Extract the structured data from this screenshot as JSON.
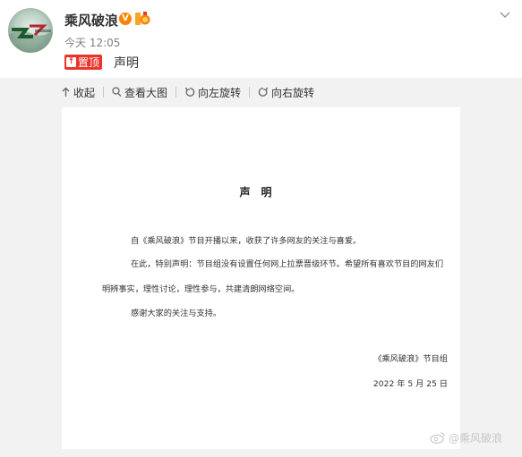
{
  "post": {
    "username": "乘风破浪",
    "verified_badge": "V",
    "timestamp": "今天 12:05",
    "pin_label": "置顶",
    "text": "声明"
  },
  "toolbar": {
    "collapse": "收起",
    "view_large": "查看大图",
    "rotate_left": "向左旋转",
    "rotate_right": "向右旋转"
  },
  "document": {
    "title": "声明",
    "paragraph1": "自《乘风破浪》节目开播以来，收获了许多网友的关注与喜爱。",
    "paragraph2_line1": "在此，特别声明：节目组没有设置任何网上拉票晋级环节。希望所有喜欢节目的网友们",
    "paragraph2_line2": "明辨事实，理性讨论，理性参与，共建清朗网络空间。",
    "paragraph3": "感谢大家的关注与支持。",
    "signature": "《乘风破浪》节目组",
    "date": "2022 年 5 月 25 日"
  },
  "watermark": {
    "text": "@乘风破浪"
  },
  "colors": {
    "accent_orange": "#ff8200",
    "pin_red": "#e8362d",
    "page_bg": "#f2f2f2"
  },
  "icons": {
    "collapse": "arrow-up-icon",
    "view_large": "magnifier-icon",
    "rotate_left": "rotate-left-icon",
    "rotate_right": "rotate-right-icon",
    "menu": "chevron-down-icon"
  }
}
